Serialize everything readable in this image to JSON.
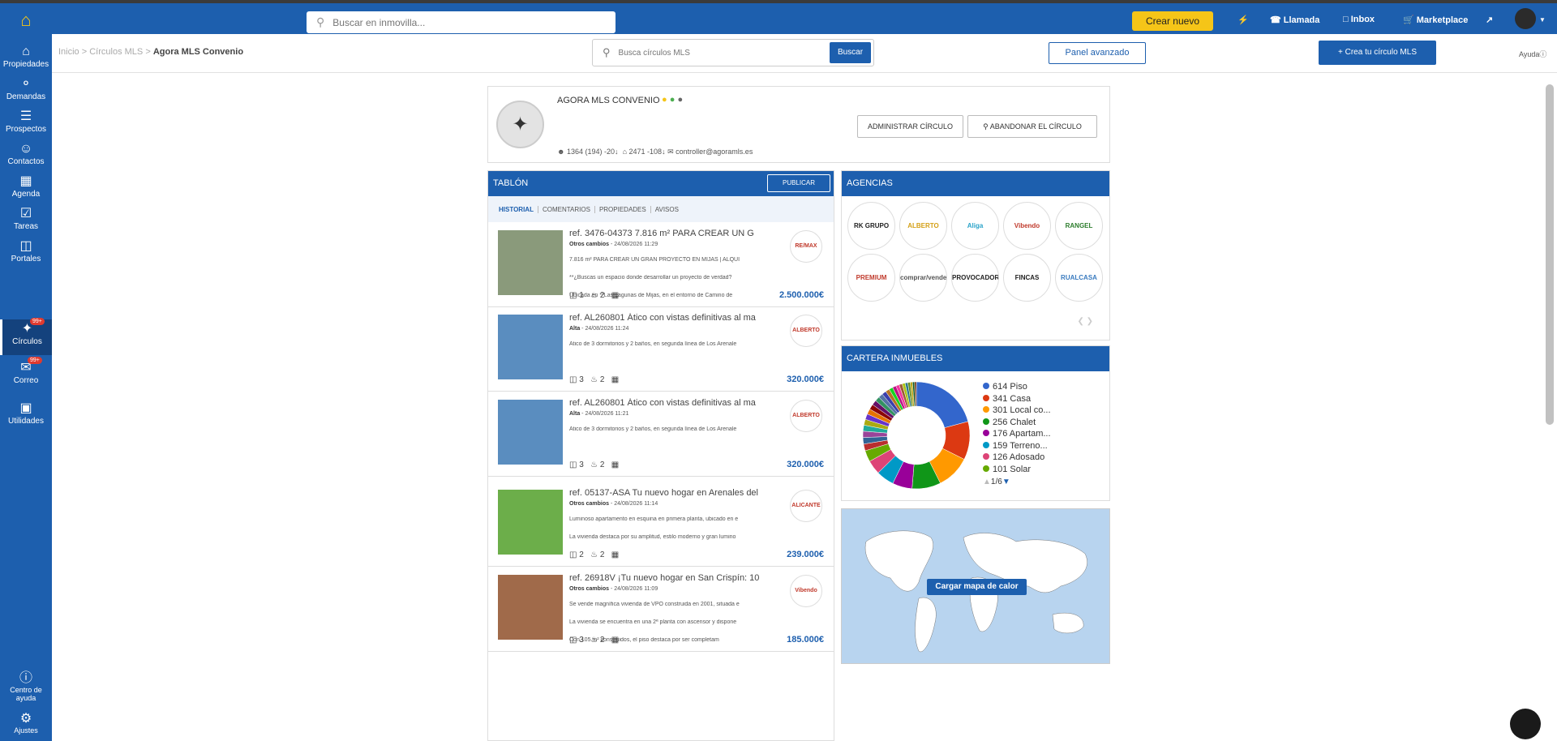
{
  "topbar": {
    "search_placeholder": "Buscar en inmovilla...",
    "create_label": "Crear nuevo",
    "llamada": "Llamada",
    "inbox": "Inbox",
    "marketplace": "Marketplace"
  },
  "sidebar": {
    "items": [
      {
        "label": "Propiedades"
      },
      {
        "label": "Demandas"
      },
      {
        "label": "Prospectos"
      },
      {
        "label": "Contactos"
      },
      {
        "label": "Agenda"
      },
      {
        "label": "Tareas"
      },
      {
        "label": "Portales"
      },
      {
        "label": "Círculos",
        "badge": "99+"
      },
      {
        "label": "Correo",
        "badge": "99+"
      },
      {
        "label": "Utilidades"
      }
    ],
    "help_label_1": "Centro de",
    "help_label_2": "ayuda",
    "settings_label": "Ajustes"
  },
  "breadcrumb": {
    "home": "Inicio",
    "circles": "Círculos MLS",
    "current": "Agora MLS Convenio"
  },
  "circle_search": {
    "placeholder": "Busca círculos MLS",
    "button": "Buscar"
  },
  "panel_button": "Panel avanzado",
  "create_circle_button": "Crea tu círculo MLS",
  "help_link": "Ayuda",
  "circle": {
    "name": "AGORA MLS CONVENIO",
    "admin_button": "ADMINISTRAR CÍRCULO",
    "leave_button": "ABANDONAR EL CÍRCULO",
    "stat_users": "1364 (194) -20",
    "stat_props": "2471 -108",
    "email": "controller@agoramls.es"
  },
  "tablon": {
    "title": "TABLÓN",
    "publish": "PUBLICAR",
    "tabs": [
      "HISTORIAL",
      "COMENTARIOS",
      "PROPIEDADES",
      "AVISOS"
    ],
    "posts": [
      {
        "title": "ref. 3476-04373 7.816 m² PARA CREAR UN G",
        "type": "Otros cambios",
        "date": " - 24/08/2026 11:29",
        "desc": [
          "7.816 m² PARA CREAR UN GRAN PROYECTO EN MIJAS | ALQUI",
          "**¿Buscas un espacio donde desarrollar un proyecto de verdad?",
          "Ubicada en **Las Lagunas de Mijas, en el entorno de Camino de"
        ],
        "beds": "1",
        "baths": "2",
        "price": "2.500.000€",
        "agency": "RE/MAX"
      },
      {
        "title": "ref. AL260801 Ático con vistas definitivas al ma",
        "type": "Alta",
        "date": " - 24/08/2026 11:24",
        "desc": [
          "Ático de 3 dormitorios y 2 baños, en segunda línea de Los Arenale"
        ],
        "beds": "3",
        "baths": "2",
        "price": "320.000€",
        "agency": "ALBERTO"
      },
      {
        "title": "ref. AL260801 Ático con vistas definitivas al ma",
        "type": "Alta",
        "date": " - 24/08/2026 11:21",
        "desc": [
          "Ático de 3 dormitorios y 2 baños, en segunda línea de Los Arenale"
        ],
        "beds": "3",
        "baths": "2",
        "price": "320.000€",
        "agency": "ALBERTO"
      },
      {
        "title": "ref. 05137-ASA Tu nuevo hogar en Arenales del",
        "type": "Otros cambios",
        "date": " - 24/08/2026 11:14",
        "desc": [
          "Luminoso apartamento en esquina en primera planta, ubicado en e",
          "La vivienda destaca por su amplitud, estilo moderno y gran lumino"
        ],
        "beds": "2",
        "baths": "2",
        "price": "239.000€",
        "agency": "ALICANTE"
      },
      {
        "title": "ref. 26918V ¡Tu nuevo hogar en San Crispín: 10",
        "type": "Otros cambios",
        "date": " - 24/08/2026 11:09",
        "desc": [
          "Se vende magnífica vivienda de VPO construida en 2001, situada e",
          "La vivienda se encuentra en una 2ª planta con ascensor y dispone",
          "Con 105 m² construidos, el piso destaca por ser completam"
        ],
        "beds": "3",
        "baths": "2",
        "price": "185.000€",
        "agency": "Vibendo"
      }
    ]
  },
  "agencias": {
    "title": "AGENCIAS",
    "logos": [
      "RK GRUPO RECOES",
      "ALBERTO LÓPEZ",
      "Aliga",
      "Vibendo",
      "RANGEL",
      "PREMIUM",
      "comprar/vender",
      "PROVOCADOR",
      "FINCAS DUEÑAS",
      "RUALCASA"
    ]
  },
  "cartera": {
    "title": "CARTERA INMUEBLES",
    "legend": [
      {
        "label": "614 Piso",
        "color": "#3366cc"
      },
      {
        "label": "341 Casa",
        "color": "#dc3912"
      },
      {
        "label": "301 Local co...",
        "color": "#ff9900"
      },
      {
        "label": "256 Chalet",
        "color": "#109618"
      },
      {
        "label": "176 Apartam...",
        "color": "#990099"
      },
      {
        "label": "159 Terreno...",
        "color": "#0099c6"
      },
      {
        "label": "126 Adosado",
        "color": "#dd4477"
      },
      {
        "label": "101 Solar",
        "color": "#66aa00"
      }
    ],
    "pager": "1/6"
  },
  "chart_data": {
    "type": "pie",
    "categories": [
      "Piso",
      "Casa",
      "Local co...",
      "Chalet",
      "Apartam...",
      "Terreno...",
      "Adosado",
      "Solar"
    ],
    "values": [
      614,
      341,
      301,
      256,
      176,
      159,
      126,
      101
    ],
    "title": ""
  },
  "mapa": {
    "button": "Cargar mapa de calor"
  }
}
